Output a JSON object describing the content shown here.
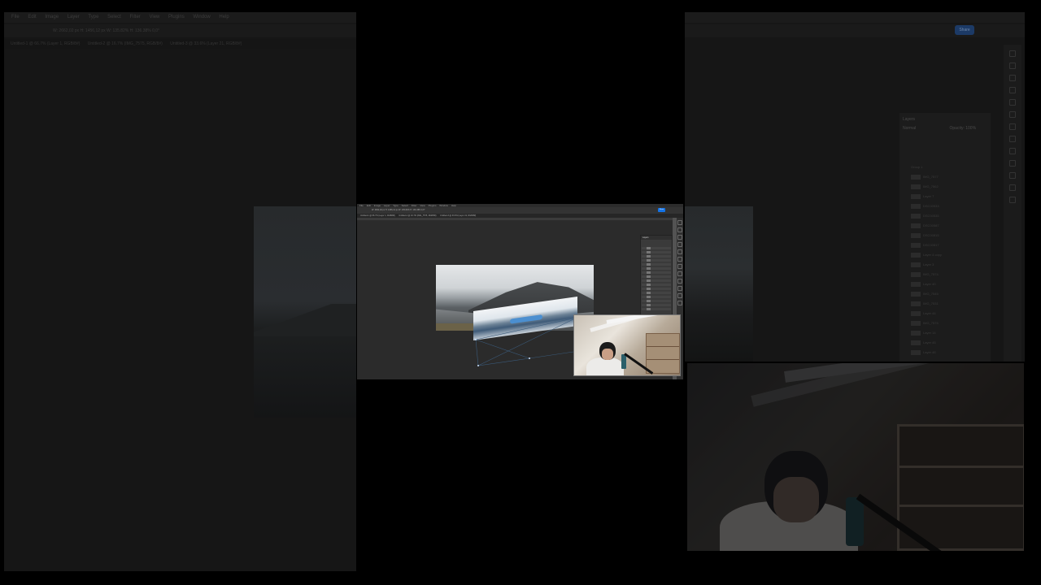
{
  "background": {
    "menu_items": [
      "File",
      "Edit",
      "Image",
      "Layer",
      "Type",
      "Select",
      "Filter",
      "View",
      "Plugins",
      "Window",
      "Help"
    ],
    "document_tabs": [
      "Untitled-1 @ 66.7% (Layer 1, RGB/8#)",
      "Untitled-2 @ 16.7% (IMG_7575, RGB/8#)",
      "Untitled-3 @ 33.6% (Layer 21, RGB/8#)"
    ],
    "options_text": "W: 2662,02 px   H: 1456,12 px   W: 135.82%   H: 136.38%   0,0°",
    "share_label": "Share",
    "layers_panel_title": "Layers",
    "blend_mode": "Normal",
    "opacity_label": "Opacity: 100%",
    "layers": [
      "Group 1",
      "IMG_7577",
      "IMG_7562",
      "Layer 7",
      "DSC00533",
      "DSC00535",
      "DSC00587",
      "DSC00815",
      "DSC00817",
      "Layer 4 copy",
      "Layer 3",
      "IMG_7574",
      "Layer 40",
      "IMG_7545",
      "IMG_7531",
      "Layer 44",
      "IMG_7575",
      "Layer 14",
      "Layer 45",
      "Layer 46"
    ]
  },
  "screen": {
    "menu_items": [
      "File",
      "Edit",
      "Image",
      "Layer",
      "Type",
      "Select",
      "Filter",
      "View",
      "Plugins",
      "Window",
      "Help"
    ],
    "options_text": "W: 2662,02 px   H: 1456,12 px   W: 135.82%   H: 136.38%   0,0°",
    "share_label": "Share",
    "document_tabs": [
      "Untitled-1 @ 66.7% (Layer 1, RGB/8#)",
      "Untitled-2 @ 16.7% (IMG_7575, RGB/8#)",
      "Untitled-3 @ 33.6% (Layer 21, RGB/8#)"
    ],
    "layers_panel_title": "Layers"
  }
}
